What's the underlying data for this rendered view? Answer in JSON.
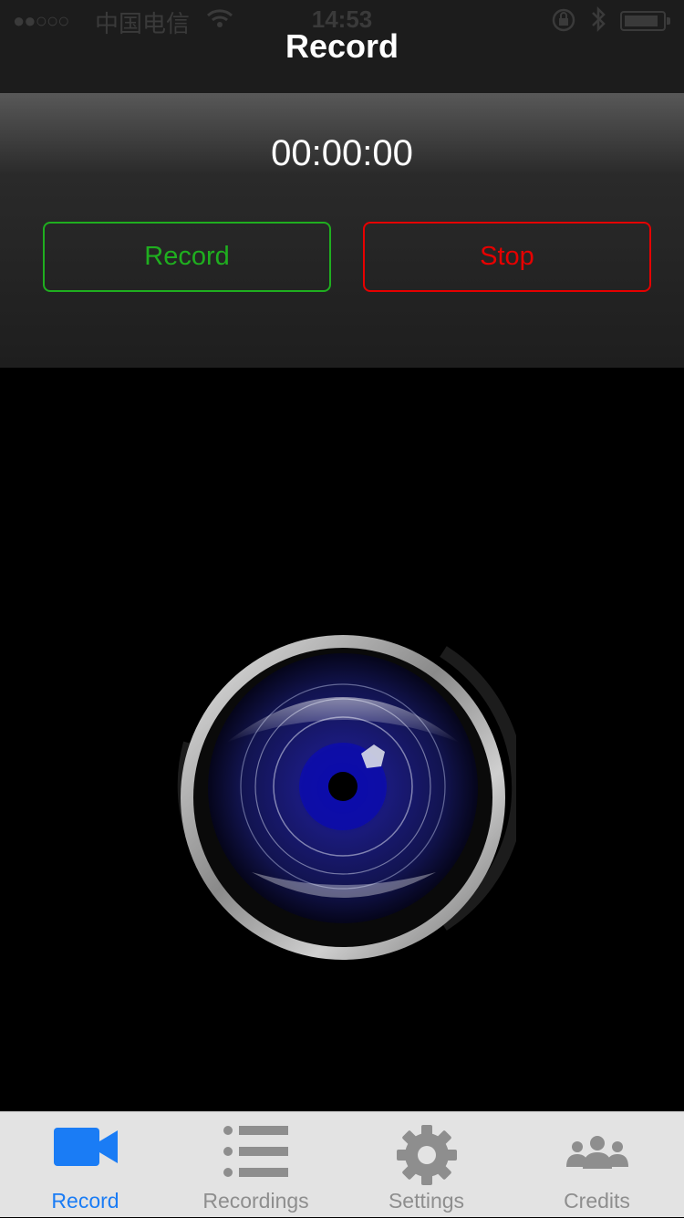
{
  "status_bar": {
    "signal": "●●○○○",
    "carrier": "中国电信",
    "time": "14:53"
  },
  "nav": {
    "title": "Record"
  },
  "recorder": {
    "timer": "00:00:00",
    "record_label": "Record",
    "stop_label": "Stop"
  },
  "tab_bar": {
    "tabs": [
      {
        "label": "Record",
        "icon": "video-camera-icon",
        "active": true
      },
      {
        "label": "Recordings",
        "icon": "list-icon",
        "active": false
      },
      {
        "label": "Settings",
        "icon": "gear-icon",
        "active": false
      },
      {
        "label": "Credits",
        "icon": "people-icon",
        "active": false
      }
    ]
  },
  "colors": {
    "record_green": "#1fae1f",
    "stop_red": "#e60000",
    "tab_active": "#1a7cf5",
    "tab_inactive": "#8e8e8e"
  }
}
